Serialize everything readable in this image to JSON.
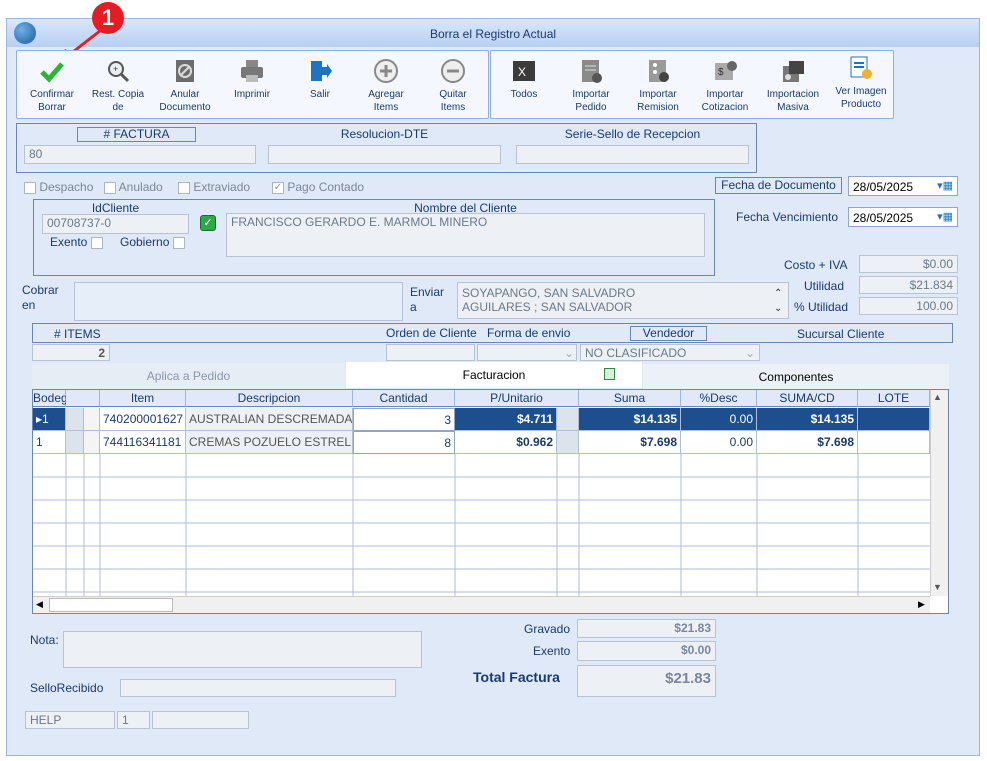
{
  "window": {
    "title": "Borra el Registro Actual"
  },
  "callout": {
    "number": "1"
  },
  "toolbar": {
    "group1": [
      {
        "label1": "Confirmar",
        "label2": "Borrar"
      },
      {
        "label1": "Rest. Copia",
        "label2": "de"
      },
      {
        "label1": "Anular",
        "label2": "Documento"
      },
      {
        "label1": "Imprimir",
        "label2": ""
      },
      {
        "label1": "Salir",
        "label2": ""
      },
      {
        "label1": "Agregar",
        "label2": "Items"
      },
      {
        "label1": "Quitar",
        "label2": "Items"
      }
    ],
    "group2": [
      {
        "label1": "Todos",
        "label2": ""
      },
      {
        "label1": "Importar",
        "label2": "Pedido"
      },
      {
        "label1": "Importar",
        "label2": "Remision"
      },
      {
        "label1": "Importar",
        "label2": "Cotizacion"
      },
      {
        "label1": "Importacion",
        "label2": "Masiva"
      },
      {
        "label1": "Ver Imagen",
        "label2": "Producto"
      }
    ]
  },
  "doc": {
    "factura_label": "# FACTURA",
    "factura_value": "80",
    "resolucion_label": "Resolucion-DTE",
    "resolucion_value": "",
    "sello_label": "Serie-Sello de Recepcion",
    "sello_value": ""
  },
  "flags": {
    "despacho": "Despacho",
    "anulado": "Anulado",
    "extraviado": "Extraviado",
    "pago_contado": "Pago Contado"
  },
  "fechas": {
    "doc_label": "Fecha de  Documento",
    "doc_value": "28/05/2025",
    "venc_label": "Fecha Vencimiento",
    "venc_value": "28/05/2025"
  },
  "cliente": {
    "id_label": "IdCliente",
    "id_value": "00708737-0",
    "nombre_label": "Nombre del Cliente",
    "nombre_value": "FRANCISCO GERARDO E. MARMOL MINERO",
    "exento": "Exento",
    "gobierno": "Gobierno"
  },
  "costos": {
    "costo_label": "Costo + IVA",
    "costo_value": "$0.00",
    "utilidad_label": "Utilidad",
    "utilidad_value": "$21.834",
    "putilidad_label": "% Utilidad",
    "putilidad_value": "100.00"
  },
  "cobrar": {
    "label1": "Cobrar",
    "label2": "en",
    "value": ""
  },
  "enviar": {
    "label1": "Enviar",
    "label2": "a",
    "line1": "SOYAPANGO, SAN SALVADRO",
    "line2": "AGUILARES ; SAN SALVADOR"
  },
  "info": {
    "items_label": "# ITEMS",
    "items_value": "2",
    "orden_label": "Orden de Cliente",
    "forma_label": "Forma de envio",
    "vendedor_label": "Vendedor",
    "vendedor_value": "NO CLASIFICADO",
    "sucursal_label": "Sucursal Cliente"
  },
  "tabs": {
    "aplica": "Aplica a Pedido",
    "facturacion": "Facturacion",
    "componentes": "Componentes"
  },
  "grid": {
    "columns": [
      "Bodega",
      "Item",
      "Descripcion",
      "Cantidad",
      "P/Unitario",
      "Suma",
      "%Desc",
      "SUMA/CD",
      "LOTE"
    ],
    "rows": [
      {
        "bodega": "1",
        "item": "740200001627",
        "descripcion": "AUSTRALIAN DESCREMADA",
        "cantidad": "3",
        "punitario": "$4.711",
        "suma": "$14.135",
        "desc": "0.00",
        "sumacd": "$14.135",
        "lote": ""
      },
      {
        "bodega": "1",
        "item": "744116341181",
        "descripcion": "CREMAS POZUELO ESTREL",
        "cantidad": "8",
        "punitario": "$0.962",
        "suma": "$7.698",
        "desc": "0.00",
        "sumacd": "$7.698",
        "lote": ""
      }
    ]
  },
  "footer": {
    "nota_label": "Nota:",
    "sello_label": "SelloRecibido",
    "gravado_label": "Gravado",
    "gravado_value": "$21.83",
    "exento_label": "Exento",
    "exento_value": "$0.00",
    "total_label": "Total Factura",
    "total_value": "$21.83",
    "status1": "HELP",
    "status2": "1"
  }
}
